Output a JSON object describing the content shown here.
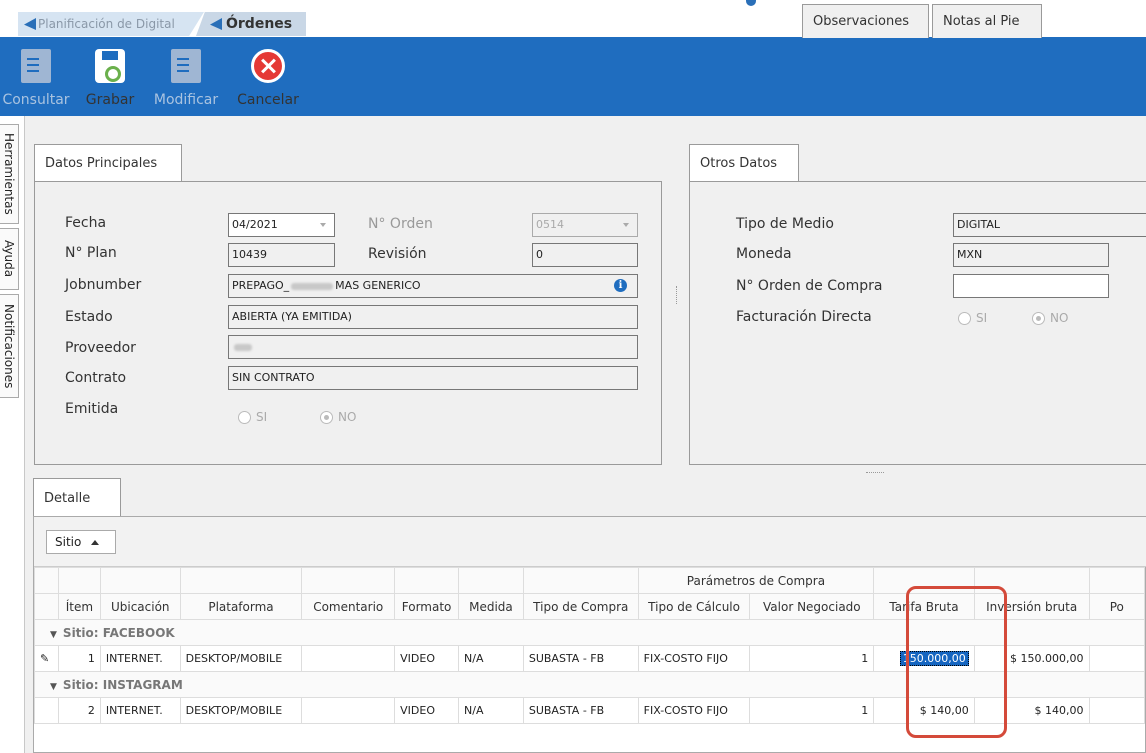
{
  "tabs": [
    {
      "label": "Planificación de Digital",
      "active": false
    },
    {
      "label": "Órdenes",
      "active": true
    }
  ],
  "toolbar": {
    "consultar": "Consultar",
    "grabar": "Grabar",
    "modificar": "Modificar",
    "cancelar": "Cancelar"
  },
  "side_tabs": [
    "Herramientas",
    "Ayuda",
    "Notificaciones"
  ],
  "datos_principales": {
    "tab": "Datos Principales",
    "fecha_label": "Fecha",
    "fecha": "04/2021",
    "orden_label": "N° Orden",
    "orden": "0514",
    "plan_label": "N° Plan",
    "plan": "10439",
    "revision_label": "Revisión",
    "revision": "0",
    "jobnumber_label": "Jobnumber",
    "jobnumber_a": "PREPAGO_",
    "jobnumber_b": "MAS GENERICO",
    "estado_label": "Estado",
    "estado": "ABIERTA (YA EMITIDA)",
    "proveedor_label": "Proveedor",
    "contrato_label": "Contrato",
    "contrato": "SIN CONTRATO",
    "emitida_label": "Emitida",
    "si": "SI",
    "no": "NO"
  },
  "otros": {
    "tab_otros": "Otros Datos",
    "tab_obs": "Observaciones",
    "tab_notas": "Notas al Pie",
    "tipo_medio_label": "Tipo de Medio",
    "tipo_medio": "DIGITAL",
    "moneda_label": "Moneda",
    "moneda": "MXN",
    "oc_label": "N° Orden de Compra",
    "oc": "",
    "fact_label": "Facturación Directa",
    "si": "SI",
    "no": "NO"
  },
  "detalle": {
    "tab": "Detalle",
    "groupby": "Sitio",
    "band": "Parámetros de Compra",
    "columns": [
      "Ítem",
      "Ubicación",
      "Plataforma",
      "Comentario",
      "Formato",
      "Medida",
      "Tipo de Compra",
      "Tipo de Cálculo",
      "Valor Negociado",
      "Tarifa Bruta",
      "Inversión bruta",
      "Po"
    ],
    "groups": [
      {
        "label": "Sitio: FACEBOOK",
        "row": {
          "item": "1",
          "ubicacion": "INTERNET.",
          "plataforma": "DESKTOP/MOBILE",
          "comentario": "",
          "formato": "VIDEO",
          "medida": "N/A",
          "tipo_compra": "SUBASTA - FB",
          "tipo_calculo": "FIX-COSTO FIJO",
          "valor": "1",
          "tarifa": "150.000,00",
          "inversion": "$ 150.000,00"
        }
      },
      {
        "label": "Sitio: INSTAGRAM",
        "row": {
          "item": "2",
          "ubicacion": "INTERNET.",
          "plataforma": "DESKTOP/MOBILE",
          "comentario": "",
          "formato": "VIDEO",
          "medida": "N/A",
          "tipo_compra": "SUBASTA - FB",
          "tipo_calculo": "FIX-COSTO FIJO",
          "valor": "1",
          "tarifa": "$ 140,00",
          "inversion": "$ 140,00"
        }
      }
    ]
  }
}
